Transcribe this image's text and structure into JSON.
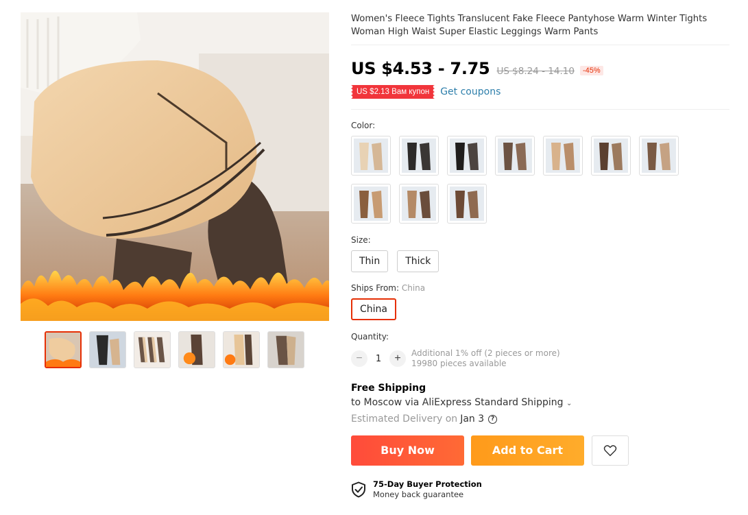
{
  "product": {
    "title": "Women's Fleece Tights Translucent Fake Fleece Pantyhose Warm Winter Tights Woman High Waist Super Elastic Leggings Warm Pants",
    "price": "US $4.53 - 7.75",
    "old_price": "US $8.24 - 14.10",
    "discount": "-45%",
    "coupon": "US $2.13 Вам купон",
    "get_coupons": "Get coupons"
  },
  "color": {
    "label": "Color:",
    "swatch_count": 10
  },
  "size": {
    "label": "Size:",
    "options": [
      "Thin",
      "Thick"
    ]
  },
  "ships_from": {
    "label": "Ships From:",
    "selected": "China",
    "options": [
      "China"
    ]
  },
  "quantity": {
    "label": "Quantity:",
    "minus": "−",
    "value": "1",
    "plus": "+",
    "note1": "Additional 1% off (2 pieces or more)",
    "note2": "19980 pieces available"
  },
  "shipping": {
    "title": "Free Shipping",
    "line": "to Moscow via AliExpress Standard Shipping",
    "chevron": "⌄",
    "estimated": "Estimated Delivery on",
    "date": "Jan 3",
    "help": "?"
  },
  "actions": {
    "buy_now": "Buy Now",
    "add_to_cart": "Add to Cart"
  },
  "protection": {
    "title": "75-Day Buyer Protection",
    "subtitle": "Money back guarantee"
  },
  "colors": {
    "accent": "#e62e04",
    "buy": "#ff4b3a",
    "cart": "#ffa51f",
    "link": "#2e7fab"
  }
}
